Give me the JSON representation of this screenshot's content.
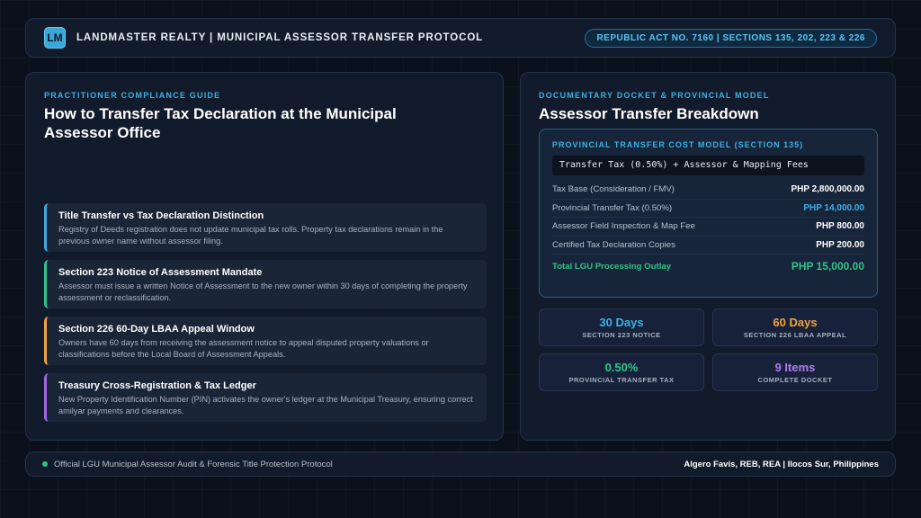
{
  "header": {
    "logo_text": "LM",
    "title": "LANDMASTER REALTY | MUNICIPAL ASSESSOR TRANSFER PROTOCOL",
    "badge": "REPUBLIC ACT NO. 7160 | SECTIONS 135, 202, 223 & 226"
  },
  "left": {
    "eyebrow": "PRACTITIONER COMPLIANCE GUIDE",
    "title": "How to Transfer Tax Declaration at the Municipal Assessor Office",
    "items": [
      {
        "title": "Title Transfer vs Tax Declaration Distinction",
        "desc": "Registry of Deeds registration does not update municipal tax rolls. Property tax declarations remain in the previous owner name without assessor filing.",
        "accent": "#3fa9e0"
      },
      {
        "title": "Section 223 Notice of Assessment Mandate",
        "desc": "Assessor must issue a written Notice of Assessment to the new owner within 30 days of completing the property assessment or reclassification.",
        "accent": "#2fc489"
      },
      {
        "title": "Section 226 60-Day LBAA Appeal Window",
        "desc": "Owners have 60 days from receiving the assessment notice to appeal disputed property valuations or classifications before the Local Board of Assessment Appeals.",
        "accent": "#f2a33a"
      },
      {
        "title": "Treasury Cross-Registration & Tax Ledger",
        "desc": "New Property Identification Number (PIN) activates the owner's ledger at the Municipal Treasury, ensuring correct amilyar payments and clearances.",
        "accent": "#a067e0"
      }
    ]
  },
  "right": {
    "eyebrow": "DOCUMENTARY DOCKET & PROVINCIAL MODEL",
    "title": "Assessor Transfer Breakdown",
    "cost_model": {
      "eyebrow": "PROVINCIAL TRANSFER COST MODEL (SECTION 135)",
      "formula": "Transfer Tax (0.50%) + Assessor & Mapping Fees",
      "rows": [
        {
          "label": "Tax Base (Consideration / FMV)",
          "value": "PHP 2,800,000.00"
        },
        {
          "label": "Provincial Transfer Tax (0.50%)",
          "value": "PHP 14,000.00"
        },
        {
          "label": "Assessor Field Inspection & Map Fee",
          "value": "PHP 800.00"
        },
        {
          "label": "Certified Tax Declaration Copies",
          "value": "PHP 200.00"
        }
      ],
      "total_label": "Total LGU Processing Outlay",
      "total_value": "PHP 15,000.00"
    },
    "stats": [
      {
        "value": "30 Days",
        "label": "SECTION 223 NOTICE",
        "color": "#3fb0e5"
      },
      {
        "value": "60 Days",
        "label": "SECTION 226 LBAA APPEAL",
        "color": "#f2a33a"
      },
      {
        "value": "0.50%",
        "label": "PROVINCIAL TRANSFER TAX",
        "color": "#2fc489"
      },
      {
        "value": "9 Items",
        "label": "COMPLETE DOCKET",
        "color": "#b07cf0"
      }
    ]
  },
  "footer": {
    "left": "Official LGU Municipal Assessor Audit & Forensic Title Protection Protocol",
    "right": "Algero Favis, REB, REA | Ilocos Sur, Philippines"
  }
}
